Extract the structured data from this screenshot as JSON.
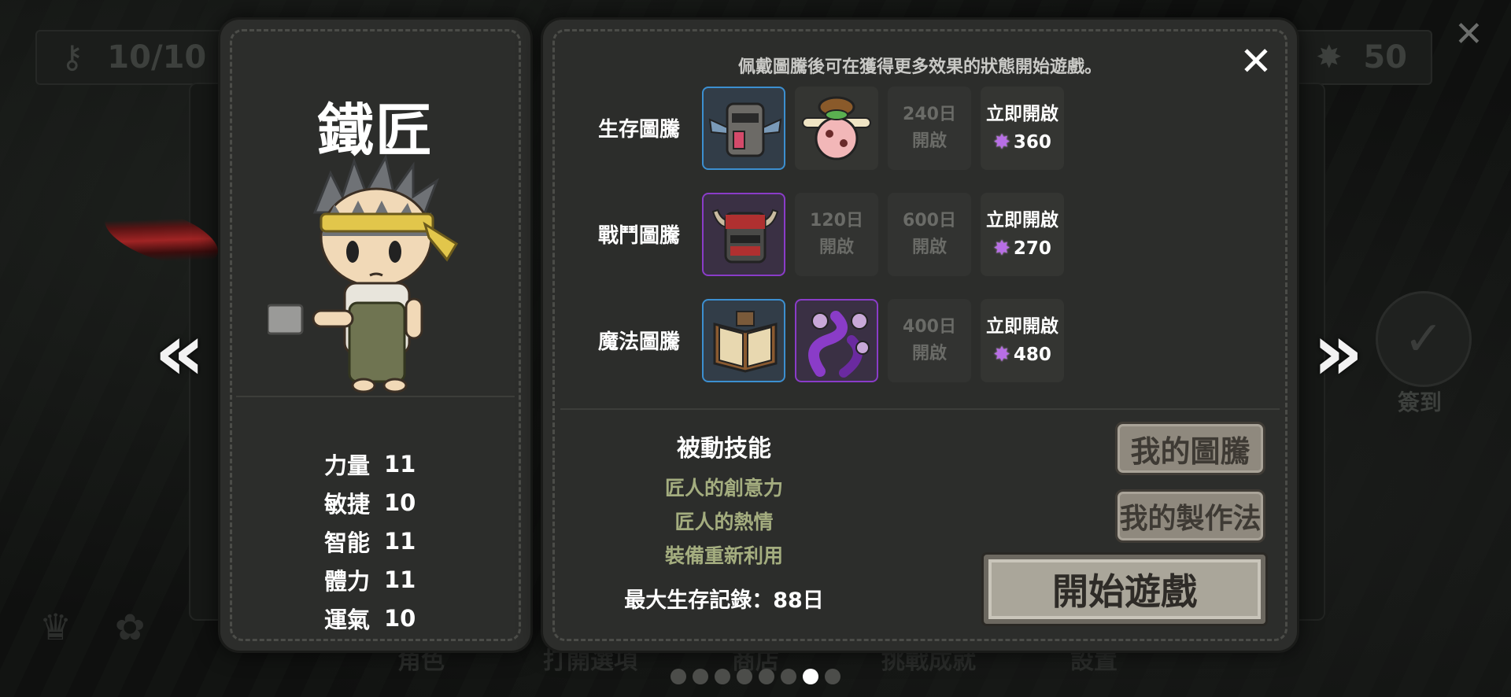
{
  "background": {
    "keys_count": "10/10",
    "gems_count": "50",
    "checkin_label": "簽到",
    "bottom_tabs": [
      "角色",
      "打開選項",
      "商店",
      "挑戰成就",
      "設置"
    ]
  },
  "character": {
    "name": "鐵匠",
    "stats": [
      {
        "name": "力量",
        "value": "11"
      },
      {
        "name": "敏捷",
        "value": "10"
      },
      {
        "name": "智能",
        "value": "11"
      },
      {
        "name": "體力",
        "value": "11"
      },
      {
        "name": "運氣",
        "value": "10"
      }
    ]
  },
  "totems": {
    "hint": "佩戴圖騰後可在獲得更多效果的狀態開始遊戲。",
    "rows": [
      {
        "label": "生存圖騰",
        "slots": [
          {
            "type": "owned",
            "icon": "armored-knight-totem-icon"
          },
          {
            "type": "owned",
            "icon": "bone-skull-totem-icon"
          },
          {
            "type": "locked",
            "days": "240日",
            "unlock": "開啟"
          }
        ],
        "buy_label": "立即開啟",
        "price": "360"
      },
      {
        "label": "戰鬥圖騰",
        "slots": [
          {
            "type": "owned",
            "icon": "horned-demon-totem-icon"
          },
          {
            "type": "locked",
            "days": "120日",
            "unlock": "開啟"
          },
          {
            "type": "locked",
            "days": "600日",
            "unlock": "開啟"
          }
        ],
        "buy_label": "立即開啟",
        "price": "270"
      },
      {
        "label": "魔法圖騰",
        "slots": [
          {
            "type": "owned",
            "icon": "spellbook-totem-icon"
          },
          {
            "type": "owned",
            "icon": "tentacle-totem-icon"
          },
          {
            "type": "locked",
            "days": "400日",
            "unlock": "開啟"
          }
        ],
        "buy_label": "立即開啟",
        "price": "480"
      }
    ]
  },
  "passive": {
    "title": "被動技能",
    "skills": [
      "匠人的創意力",
      "匠人的熱情",
      "裝備重新利用"
    ]
  },
  "record": "最大生存記錄：88日",
  "buttons": {
    "my_totems": "我的圖騰",
    "my_recipes": "我的製作法",
    "start_game": "開始遊戲"
  },
  "pagination": {
    "total": 8,
    "active": 7
  },
  "colors": {
    "panel": "#2c2d2b",
    "skill_text": "#a4ad7f",
    "gem": "#b86ee6",
    "blue_frame": "#3c8fd0",
    "purple_frame": "#8a3cc8"
  }
}
